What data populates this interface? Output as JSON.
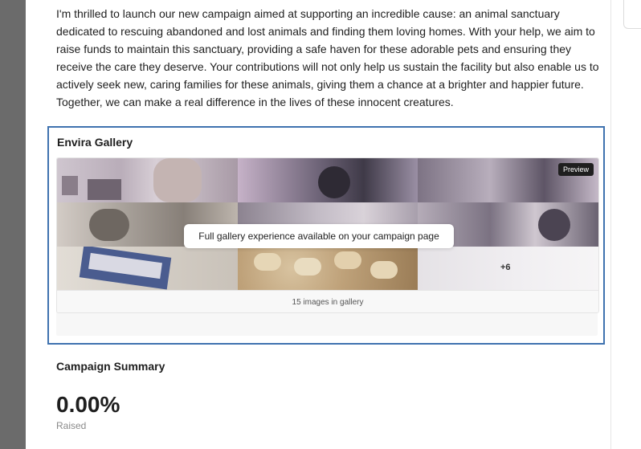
{
  "description": {
    "text": "I'm thrilled to launch our new campaign aimed at supporting an incredible cause: an animal sanctuary dedicated to rescuing abandoned and lost animals and finding them loving homes. With your help, we aim to raise funds to maintain this sanctuary, providing a safe haven for these adorable pets and ensuring they receive the care they deserve. Your contributions will not only help us sustain the facility but also enable us to actively seek new, caring families for these animals, giving them a chance at a brighter and happier future. Together, we can make a real difference in the lives of these innocent creatures."
  },
  "gallery": {
    "title": "Envira Gallery",
    "preview_label": "Preview",
    "notice": "Full gallery experience available on your campaign page",
    "more_count": "+6",
    "images_count": "15 images in gallery"
  },
  "summary": {
    "title": "Campaign Summary",
    "raised_amount": "0.00%",
    "raised_label": "Raised"
  },
  "colors": {
    "selection_border": "#3f72af",
    "left_strip": "#6b6b6b"
  }
}
